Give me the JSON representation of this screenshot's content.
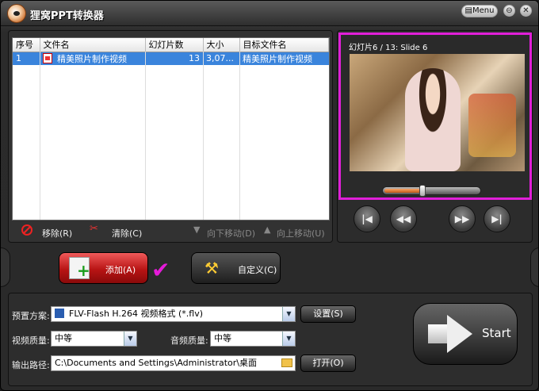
{
  "app": {
    "title": "狸窝PPT转换器",
    "menu_label": "Menu"
  },
  "file_list": {
    "columns": [
      "序号",
      "文件名",
      "幻灯片数",
      "大小",
      "目标文件名"
    ],
    "rows": [
      {
        "index": "1",
        "name": "精美照片制作视频",
        "slides": "13",
        "size": "3,07...",
        "target": "精美照片制作视频"
      }
    ]
  },
  "list_toolbar": {
    "remove": "移除(R)",
    "clear": "清除(C)",
    "move_down": "向下移动(D)",
    "move_up": "向上移动(U)"
  },
  "preview": {
    "slide_label": "幻灯片6 / 13: Slide 6",
    "position": 0.4
  },
  "actions": {
    "add": "添加(A)",
    "customize": "自定义(C)"
  },
  "settings": {
    "preset_label": "预置方案:",
    "preset_value": "FLV-Flash H.264 视频格式 (*.flv)",
    "settings_button": "设置(S)",
    "video_quality_label": "视频质量:",
    "video_quality_value": "中等",
    "audio_quality_label": "音频质量:",
    "audio_quality_value": "中等",
    "output_label": "输出路径:",
    "output_value": "C:\\Documents and Settings\\Administrator\\桌面",
    "open_button": "打开(O)",
    "start_label": "Start"
  },
  "colors": {
    "highlight": "#e01fd8",
    "selection": "#3a84dc",
    "add_button": "#c41818"
  },
  "icons": [
    "app-logo-icon",
    "menu-icon",
    "minimize-icon",
    "close-icon",
    "ppt-file-icon",
    "remove-icon",
    "clear-icon",
    "arrow-down-icon",
    "arrow-up-icon",
    "first-slide-icon",
    "rewind-icon",
    "forward-icon",
    "last-slide-icon",
    "add-file-icon",
    "tools-icon",
    "checkmark-icon",
    "film-icon",
    "dropdown-arrow-icon",
    "folder-icon",
    "start-arrow-icon"
  ]
}
